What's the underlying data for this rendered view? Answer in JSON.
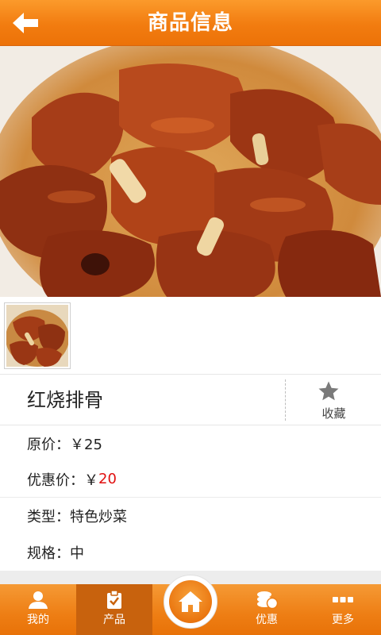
{
  "header": {
    "title": "商品信息",
    "back_icon": "arrow-left-icon"
  },
  "product": {
    "name": "红烧排骨",
    "favorite_label": "收藏",
    "favorite_icon": "star-icon",
    "original_price_label": "原价：",
    "original_price_value": "￥25",
    "sale_price_label": "优惠价：",
    "sale_price_currency": "￥",
    "sale_price_value": "20",
    "type_label": "类型：",
    "type_value": "特色炒菜",
    "size_label": "规格：",
    "size_value": "中"
  },
  "tabbar": {
    "items": [
      {
        "label": "我的",
        "icon": "user-icon"
      },
      {
        "label": "产品",
        "icon": "clipboard-icon"
      },
      {
        "label": "",
        "icon": "home-icon"
      },
      {
        "label": "优惠",
        "icon": "coins-icon"
      },
      {
        "label": "更多",
        "icon": "more-icon"
      }
    ],
    "active_index": 1
  },
  "colors": {
    "accent": "#f07c12",
    "price_red": "#e01010"
  }
}
